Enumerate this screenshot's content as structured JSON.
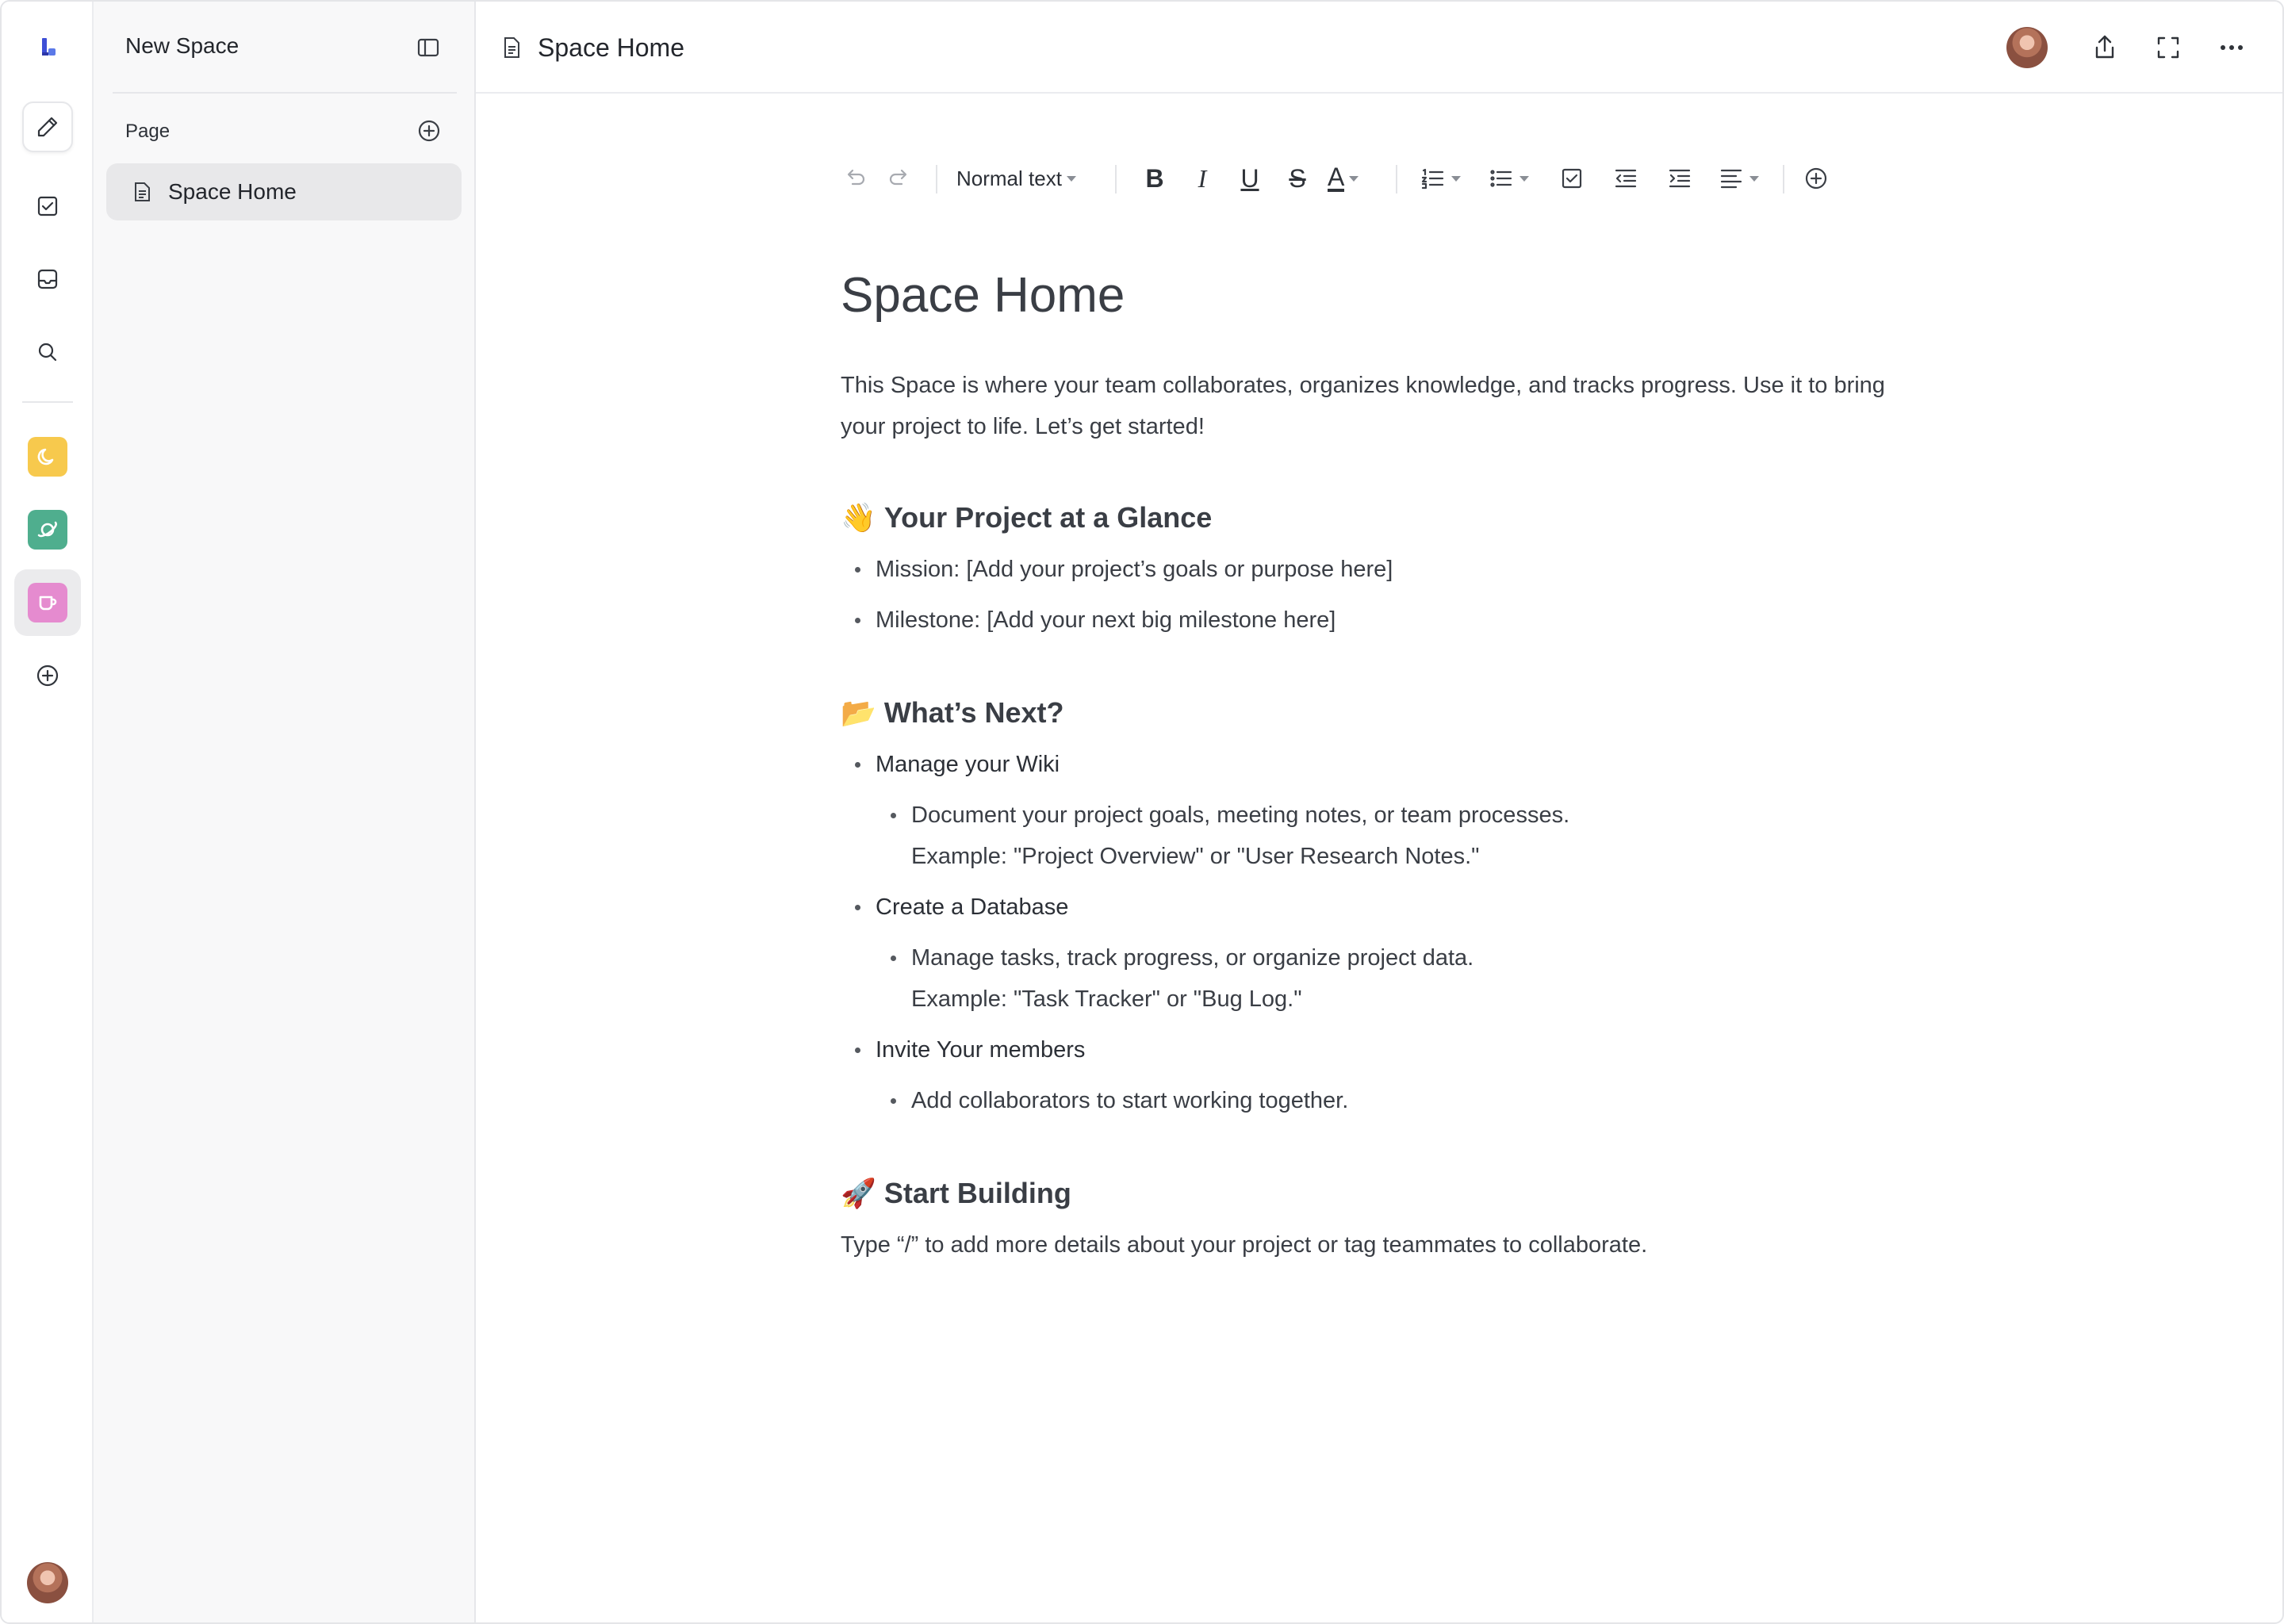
{
  "rail": {
    "items": [
      {
        "name": "compose",
        "icon": "pencil-icon"
      },
      {
        "name": "tasks",
        "icon": "checkbox-icon"
      },
      {
        "name": "inbox",
        "icon": "inbox-icon"
      },
      {
        "name": "search",
        "icon": "search-icon"
      }
    ],
    "spaces": [
      {
        "icon": "moon-icon",
        "color": "#f7c94d"
      },
      {
        "icon": "planet-icon",
        "color": "#4fae8e"
      },
      {
        "icon": "cup-icon",
        "color": "#e58bcf",
        "active": true
      }
    ]
  },
  "sidebar": {
    "title": "New Space",
    "section_label": "Page",
    "items": [
      {
        "label": "Space Home",
        "selected": true
      }
    ]
  },
  "topbar": {
    "title": "Space Home"
  },
  "toolbar": {
    "text_style": "Normal text",
    "bold": "B",
    "italic": "I",
    "underline": "U",
    "strike": "S",
    "text_color": "A"
  },
  "document": {
    "title": "Space Home",
    "intro": "This Space is where your team collaborates, organizes knowledge, and tracks progress. Use it to bring your project to life. Let’s get started!",
    "sections": [
      {
        "emoji": "👋",
        "heading": "Your Project at a Glance",
        "bullets": [
          "Mission: [Add your project’s goals or purpose here]",
          "Milestone: [Add your next big milestone here]"
        ]
      },
      {
        "emoji": "📂",
        "heading": "What’s Next?",
        "items": [
          {
            "label": "Manage your Wiki",
            "sub": [
              "Document your project goals, meeting notes, or team processes.",
              "Example: \"Project Overview\" or \"User Research Notes.\""
            ]
          },
          {
            "label": "Create a Database",
            "sub": [
              "Manage tasks, track progress, or organize project data.",
              "Example: \"Task Tracker\" or \"Bug Log.\""
            ]
          },
          {
            "label": "Invite Your members",
            "sub": [
              "Add collaborators to start working together."
            ]
          }
        ]
      },
      {
        "emoji": "🚀",
        "heading": "Start Building",
        "text": "Type “/” to add more details about your project or tag teammates to collaborate."
      }
    ]
  }
}
